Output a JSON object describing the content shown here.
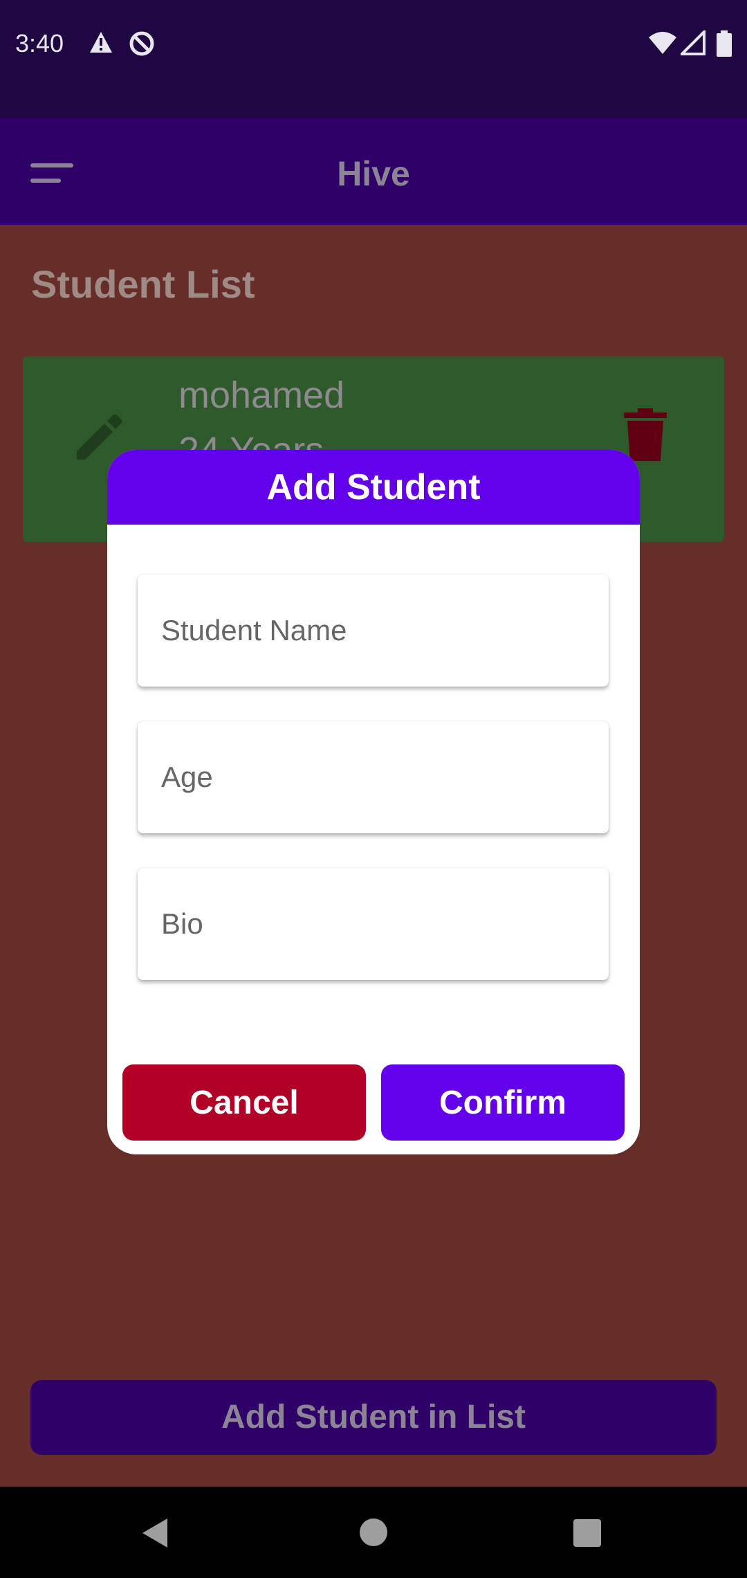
{
  "status_bar": {
    "time": "3:40"
  },
  "app_bar": {
    "title": "Hive"
  },
  "page": {
    "section_title": "Student List"
  },
  "student_list": [
    {
      "name": "mohamed",
      "age": "24 Years"
    }
  ],
  "dialog": {
    "title": "Add Student",
    "fields": {
      "name": {
        "placeholder": "Student Name",
        "value": ""
      },
      "age": {
        "placeholder": "Age",
        "value": ""
      },
      "bio": {
        "placeholder": "Bio",
        "value": ""
      }
    },
    "cancel_label": "Cancel",
    "confirm_label": "Confirm"
  },
  "bottom_button": {
    "label": "Add Student in List"
  },
  "colors": {
    "primary": "#6200ea",
    "cancel": "#b00025",
    "card": "#2e5a2b",
    "scrim_background": "#672e29"
  }
}
